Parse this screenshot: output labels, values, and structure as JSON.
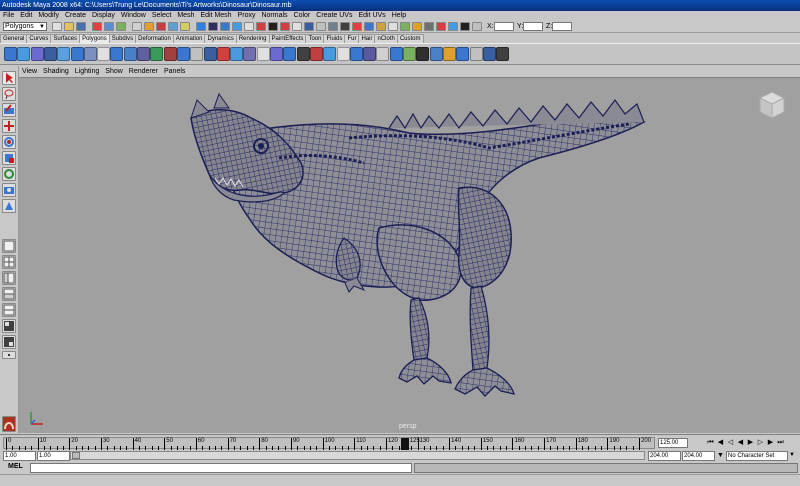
{
  "window": {
    "title": "Autodesk Maya 2008 x64: C:\\Users\\Trung Le\\Documents\\Ti's Artworks\\Dinosaur\\Dinosaur.mb"
  },
  "menu": [
    "File",
    "Edit",
    "Modify",
    "Create",
    "Display",
    "Window",
    "Select",
    "Mesh",
    "Edit Mesh",
    "Proxy",
    "Normals",
    "Color",
    "Create UVs",
    "Edit UVs",
    "Help"
  ],
  "status_line": {
    "mode": "Polygons",
    "x_label": "X:",
    "y_label": "Y:",
    "z_label": "Z:"
  },
  "shelf_tabs": [
    "General",
    "Curves",
    "Surfaces",
    "Polygons",
    "Subdivs",
    "Deformation",
    "Animation",
    "Dynamics",
    "Rendering",
    "PaintEffects",
    "Toon",
    "Fluids",
    "Fur",
    "Hair",
    "nCloth",
    "Custom"
  ],
  "shelf_active": "Polygons",
  "panel_menu": [
    "View",
    "Shading",
    "Lighting",
    "Show",
    "Renderer",
    "Panels"
  ],
  "viewport": {
    "camera_label": "persp",
    "mesh_color": "#3a3f78",
    "background": "#a0a0a0"
  },
  "timeline": {
    "ticks": [
      "0",
      "10",
      "20",
      "30",
      "40",
      "50",
      "60",
      "70",
      "80",
      "90",
      "100",
      "110",
      "120",
      "130",
      "140",
      "150",
      "160",
      "170",
      "180",
      "190",
      "200"
    ],
    "current_frame": "125",
    "current_field": "125.00"
  },
  "range": {
    "start": "1.00",
    "playback_start": "1.00",
    "playback_end": "204.00",
    "end": "204.00",
    "character_set": "No Character Set"
  },
  "mel": {
    "label": "MEL"
  }
}
